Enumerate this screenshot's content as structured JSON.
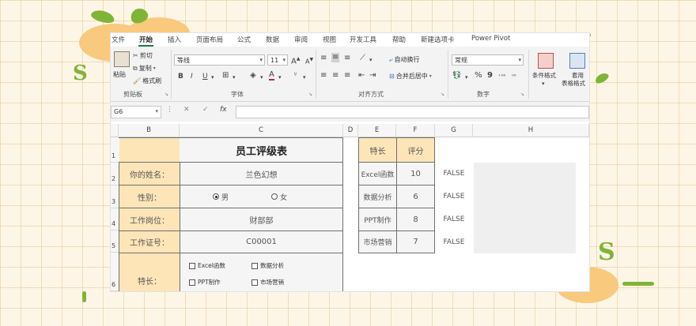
{
  "ribbon": {
    "tabs": [
      "文件",
      "开始",
      "插入",
      "页面布局",
      "公式",
      "数据",
      "审阅",
      "视图",
      "开发工具",
      "帮助",
      "新建选项卡",
      "Power Pivot"
    ],
    "active_tab": "开始",
    "clipboard": {
      "paste": "粘贴",
      "cut": "剪切",
      "copy": "复制",
      "format_painter": "格式刷",
      "group": "剪贴板"
    },
    "font": {
      "name": "等线",
      "size": "11",
      "grow": "A",
      "shrink": "A",
      "bold": "B",
      "italic": "I",
      "underline": "U",
      "group": "字体"
    },
    "alignment": {
      "wrap": "自动换行",
      "merge": "合并后居中",
      "group": "对齐方式"
    },
    "number": {
      "format": "常规",
      "percent": "%",
      "comma": "9",
      "group": "数字"
    },
    "styles": {
      "conditional": "条件格式",
      "table_line1": "套用",
      "table_line2": "表格格式"
    }
  },
  "formula_bar": {
    "cell_ref": "G6",
    "fx": "fx"
  },
  "columns": [
    "B",
    "C",
    "D",
    "E",
    "F",
    "G",
    "H"
  ],
  "rows": [
    "1",
    "2",
    "3",
    "4",
    "5",
    "6"
  ],
  "form": {
    "title": "员工评级表",
    "name_label": "你的姓名：",
    "name_value": "兰色幻想",
    "gender_label": "性别：",
    "gender_male": "男",
    "gender_female": "女",
    "position_label": "工作岗位：",
    "position_value": "财部部",
    "id_label": "工作证号：",
    "id_value": "C00001",
    "skills_label": "特长：",
    "skills": [
      "Excel函数",
      "数据分析",
      "PPT制作",
      "市场营销"
    ]
  },
  "rating": {
    "headers": [
      "特长",
      "评分"
    ],
    "rows": [
      {
        "skill": "Excel函数",
        "score": "10",
        "flag": "FALSE"
      },
      {
        "skill": "数据分析",
        "score": "6",
        "flag": "FALSE"
      },
      {
        "skill": "PPT制作",
        "score": "8",
        "flag": "FALSE"
      },
      {
        "skill": "市场营销",
        "score": "7",
        "flag": "FALSE"
      }
    ]
  },
  "colors": {
    "label_fill": "#fde5b8",
    "accent": "#217346",
    "background": "#fdf6e6",
    "decor_green": "#7fb536",
    "decor_orange": "#f9c97d"
  }
}
